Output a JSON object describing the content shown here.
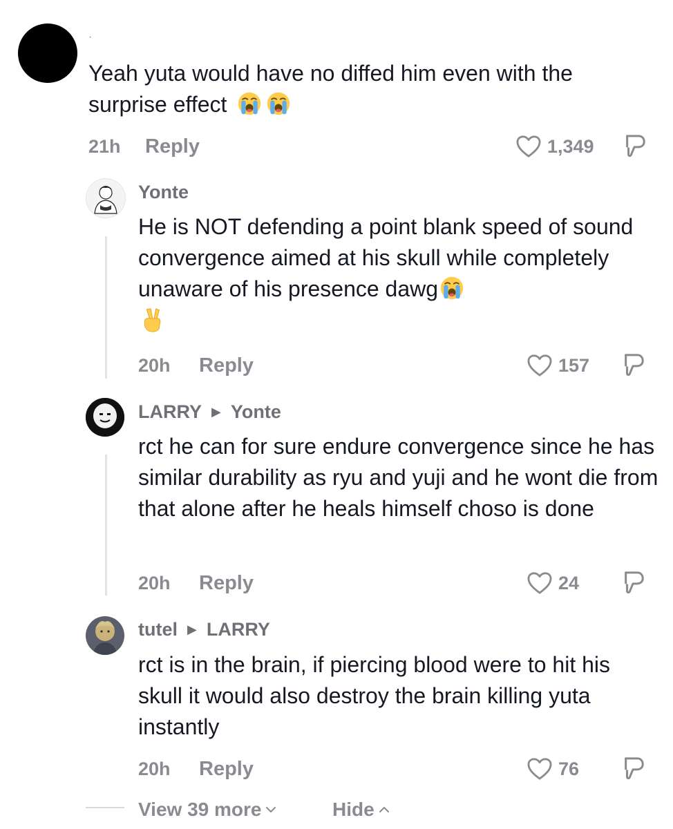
{
  "comment": {
    "username": "·",
    "text": "Yeah yuta would have no diffed him even with the surprise effect",
    "emojis": [
      "loudly-crying-face",
      "loudly-crying-face"
    ],
    "time": "21h",
    "reply_label": "Reply",
    "likes": "1,349"
  },
  "replies": [
    {
      "username": "Yonte",
      "reply_to": "",
      "text": "He is NOT defending a point blank speed of sound convergence aimed at his skull while completely unaware of his presence dawg",
      "emojis": [
        "loudly-crying-face",
        "victory-hand"
      ],
      "time": "20h",
      "reply_label": "Reply",
      "likes": "157"
    },
    {
      "username": "LARRY",
      "reply_to": "Yonte",
      "text": "rct he can for sure endure convergence since he has similar durability as ryu and yuji and he wont die from that alone after he heals himself choso is done",
      "time": "20h",
      "reply_label": "Reply",
      "likes": "24"
    },
    {
      "username": "tutel",
      "reply_to": "LARRY",
      "text": "rct is in the brain, if piercing blood were to hit his skull it would also destroy the brain killing yuta instantly",
      "time": "20h",
      "reply_label": "Reply",
      "likes": "76"
    }
  ],
  "footer": {
    "view_more": "View 39 more",
    "hide": "Hide"
  },
  "colors": {
    "text": "#161823",
    "muted": "#8a8b91",
    "username": "#6f7077"
  }
}
